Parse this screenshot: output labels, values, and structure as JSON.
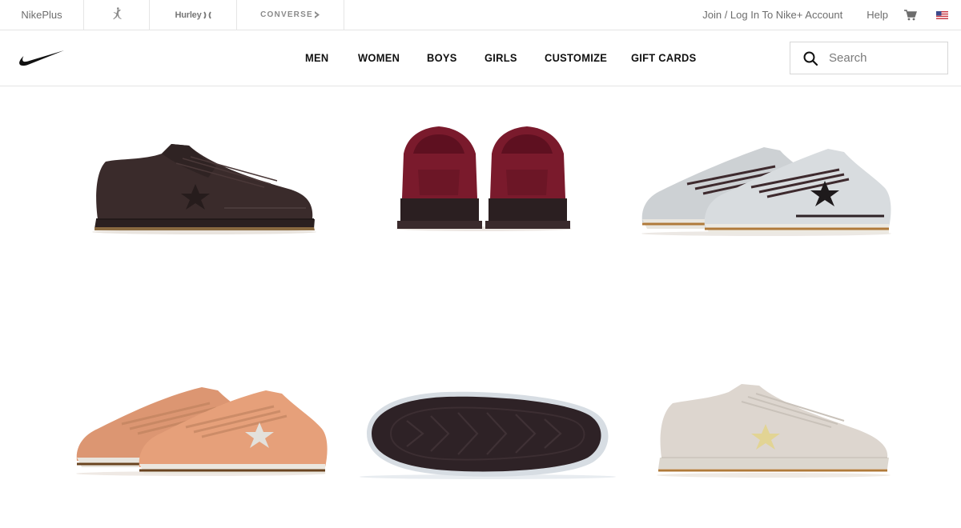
{
  "topbar": {
    "brands": [
      {
        "label": "NikePlus"
      },
      {
        "label": "",
        "icon": "jumpman-icon"
      },
      {
        "label": "Hurley"
      },
      {
        "label": "CONVERSE"
      }
    ],
    "account_link": "Join / Log In To Nike+ Account",
    "help_link": "Help",
    "cart_icon": "cart-icon",
    "region_icon": "us-flag-icon"
  },
  "nav": {
    "logo_icon": "nike-swoosh-icon",
    "items": [
      {
        "label": "MEN"
      },
      {
        "label": "WOMEN"
      },
      {
        "label": "BOYS"
      },
      {
        "label": "GIRLS"
      },
      {
        "label": "CUSTOMIZE"
      },
      {
        "label": "GIFT CARDS"
      }
    ],
    "search": {
      "placeholder": "Search",
      "value": ""
    }
  },
  "gallery": {
    "images": [
      {
        "view": "side-dark-brown",
        "color": "#3a2a2a"
      },
      {
        "view": "back-burgundy",
        "color": "#7a1a2c"
      },
      {
        "view": "pair-metallic-silver",
        "color": "#d8dcdf"
      },
      {
        "view": "pair-peach",
        "color": "#e6a07a"
      },
      {
        "view": "sole-dark",
        "color": "#2e2226"
      },
      {
        "view": "side-cream-gold-star",
        "color": "#ddd6cf"
      }
    ]
  }
}
